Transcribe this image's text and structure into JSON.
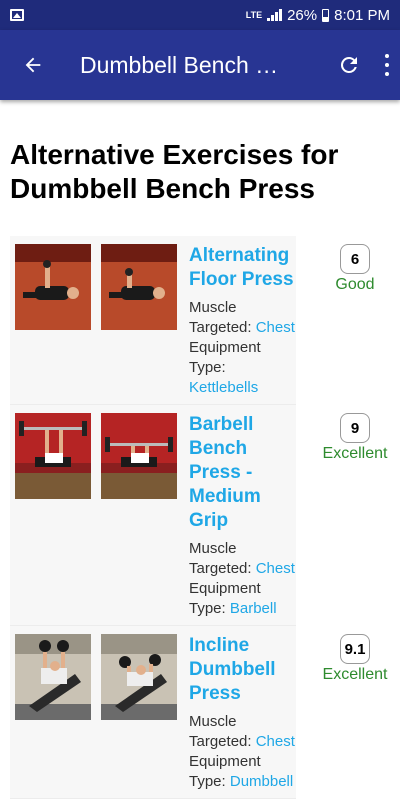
{
  "status_bar": {
    "network": "LTE",
    "battery": "26%",
    "time": "8:01 PM"
  },
  "app_bar": {
    "title": "Dumbbell Bench Press",
    "icons": [
      "back-arrow-icon",
      "refresh-icon",
      "more-vert-icon"
    ]
  },
  "heading": "Alternative Exercises for Dumbbell Bench Press",
  "exercises": [
    {
      "title": "Alternating Floor Press",
      "muscle_label": "Muscle Targeted: ",
      "muscle": "Chest",
      "equipment_label": "Equipment Type: ",
      "equipment": "Kettlebells",
      "score": "6",
      "rating": "Good"
    },
    {
      "title": "Barbell Bench Press - Medium Grip",
      "muscle_label": "Muscle Targeted: ",
      "muscle": "Chest",
      "equipment_label": "Equipment Type: ",
      "equipment": "Barbell",
      "score": "9",
      "rating": "Excellent"
    },
    {
      "title": "Incline Dumbbell Press",
      "muscle_label": "Muscle Targeted: ",
      "muscle": "Chest",
      "equipment_label": "Equipment Type: ",
      "equipment": "Dumbbell",
      "score": "9.1",
      "rating": "Excellent"
    }
  ],
  "colors": {
    "app_bar": "#283593",
    "status_bar": "#1f2b7b",
    "link": "#1fa7e6",
    "rating": "#2e8b2e"
  }
}
